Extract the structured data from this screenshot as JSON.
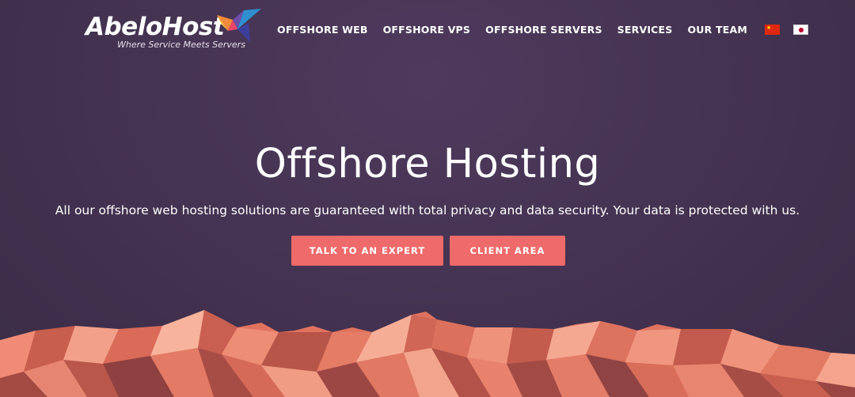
{
  "header": {
    "logo_text": "AbeloHost",
    "logo_tagline": "Where Service Meets Servers",
    "nav": [
      {
        "label": "OFFSHORE WEB"
      },
      {
        "label": "OFFSHORE VPS"
      },
      {
        "label": "OFFSHORE SERVERS"
      },
      {
        "label": "SERVICES"
      },
      {
        "label": "OUR TEAM"
      }
    ],
    "flags": [
      "china-flag-icon",
      "japan-flag-icon"
    ]
  },
  "hero": {
    "title": "Offshore Hosting",
    "subtitle": "All our offshore web hosting solutions are guaranteed with total privacy and data security. Your data is protected with us.",
    "buttons": {
      "expert": "TALK TO AN EXPERT",
      "client": "CLIENT AREA"
    }
  },
  "colors": {
    "background": "#433250",
    "button": "#ef6a6a",
    "mountains": "#e9765f"
  }
}
